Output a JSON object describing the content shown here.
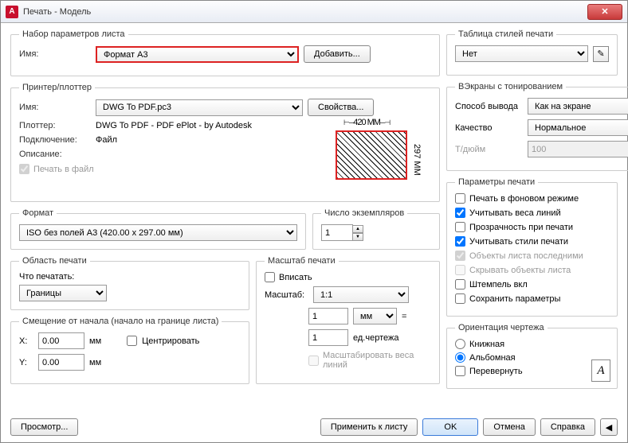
{
  "window": {
    "title": "Печать - Модель",
    "app_icon_letter": "A"
  },
  "page_setup": {
    "legend": "Набор параметров листа",
    "name_label": "Имя:",
    "name_value": "Формат А3",
    "add_button": "Добавить..."
  },
  "printer": {
    "legend": "Принтер/плоттер",
    "name_label": "Имя:",
    "name_value": "DWG To PDF.pc3",
    "props_button": "Свойства...",
    "plotter_label": "Плоттер:",
    "plotter_value": "DWG To PDF - PDF ePlot - by Autodesk",
    "connection_label": "Подключение:",
    "connection_value": "Файл",
    "description_label": "Описание:",
    "to_file_label": "Печать в файл",
    "preview_width": "420 MM",
    "preview_height": "297 MM"
  },
  "paper": {
    "legend": "Формат",
    "value": "ISO без полей A3 (420.00 x 297.00 мм)"
  },
  "copies": {
    "legend": "Число экземпляров",
    "value": "1"
  },
  "area": {
    "legend": "Область печати",
    "what_label": "Что печатать:",
    "what_value": "Границы"
  },
  "offset": {
    "legend": "Смещение от начала (начало на границе листа)",
    "x_label": "X:",
    "x_value": "0.00",
    "x_unit": "мм",
    "y_label": "Y:",
    "y_value": "0.00",
    "y_unit": "мм",
    "center_label": "Центрировать"
  },
  "scale": {
    "legend": "Масштаб печати",
    "fit_label": "Вписать",
    "scale_label": "Масштаб:",
    "scale_value": "1:1",
    "unit_paper": "1",
    "unit_paper_sel": "мм",
    "eq": "=",
    "unit_drawing": "1",
    "unit_drawing_label": "ед.чертежа",
    "scale_lw_label": "Масштабировать веса линий"
  },
  "styles": {
    "legend": "Таблица стилей печати",
    "value": "Нет"
  },
  "vports": {
    "legend": "ВЭкраны с тонированием",
    "method_label": "Способ вывода",
    "method_value": "Как на экране",
    "quality_label": "Качество",
    "quality_value": "Нормальное",
    "dpi_label": "Т/дюйм",
    "dpi_value": "100"
  },
  "options": {
    "legend": "Параметры печати",
    "bg": "Печать в фоновом режиме",
    "lw": "Учитывать веса линий",
    "trans": "Прозрачность при печати",
    "ps": "Учитывать стили печати",
    "pslast": "Объекты листа последними",
    "hide": "Скрывать объекты листа",
    "stamp": "Штемпель вкл",
    "save": "Сохранить параметры"
  },
  "orient": {
    "legend": "Ориентация чертежа",
    "portrait": "Книжная",
    "landscape": "Альбомная",
    "upside": "Перевернуть",
    "icon_letter": "A"
  },
  "buttons": {
    "preview": "Просмотр...",
    "apply": "Применить к листу",
    "ok": "OK",
    "cancel": "Отмена",
    "help": "Справка"
  }
}
